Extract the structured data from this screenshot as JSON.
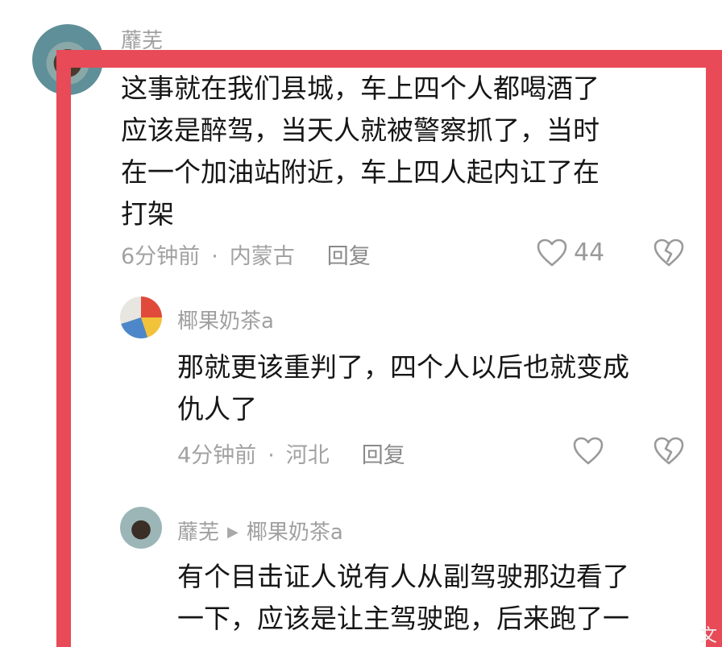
{
  "comments": {
    "main": {
      "username": "蘼芜",
      "lines": [
        "这事就在我们县城，车上四个人都喝酒了",
        "应该是醉驾，当天人就被警察抓了，当时",
        "在一个加油站附近，车上四人起内讧了在",
        "打架"
      ],
      "time": "6分钟前",
      "location": "内蒙古",
      "reply_label": "回复",
      "like_count": "44",
      "like_icon": "heart-outline-icon",
      "dislike_icon": "broken-heart-icon"
    },
    "reply1": {
      "username": "椰果奶茶a",
      "lines": [
        "那就更该重判了，四个人以后也就变成",
        "仇人了"
      ],
      "time": "4分钟前",
      "location": "河北",
      "reply_label": "回复",
      "like_icon": "heart-outline-icon",
      "dislike_icon": "broken-heart-icon"
    },
    "reply2": {
      "username": "蘼芜",
      "reply_to": "椰果奶茶a",
      "lines": [
        "有个目击证人说有人从副驾驶那边看了",
        "一下，应该是让主驾驶跑，后来跑了一"
      ]
    }
  },
  "watermark": "文",
  "colors": {
    "frame": "#e84a58",
    "text": "#161616",
    "muted": "#a0a0a0"
  }
}
